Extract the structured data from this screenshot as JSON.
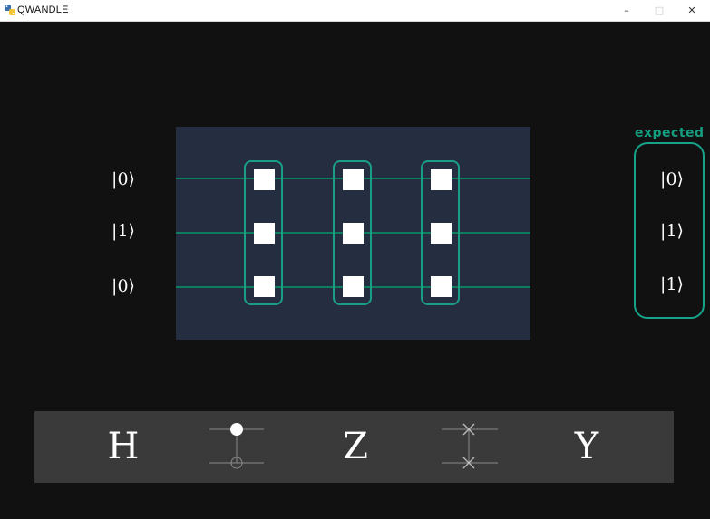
{
  "window": {
    "title": "QWANDLE",
    "minimize_glyph": "–",
    "maximize_glyph": "□",
    "close_glyph": "✕"
  },
  "input_states": [
    "|0⟩",
    "|1⟩",
    "|0⟩"
  ],
  "expected": {
    "label": "expected",
    "states": [
      "|0⟩",
      "|1⟩",
      "|1⟩"
    ]
  },
  "gates": {
    "h_label": "H",
    "cnot_icon": "cnot-gate-icon",
    "z_label": "Z",
    "swap_icon": "swap-gate-icon",
    "y_label": "Y"
  },
  "colors": {
    "background": "#111111",
    "board": "#252d40",
    "wire": "#0e7c5e",
    "slot_border": "#1a9e86",
    "expected_accent": "#169c7e",
    "gate_bar": "#3a3a3a"
  }
}
